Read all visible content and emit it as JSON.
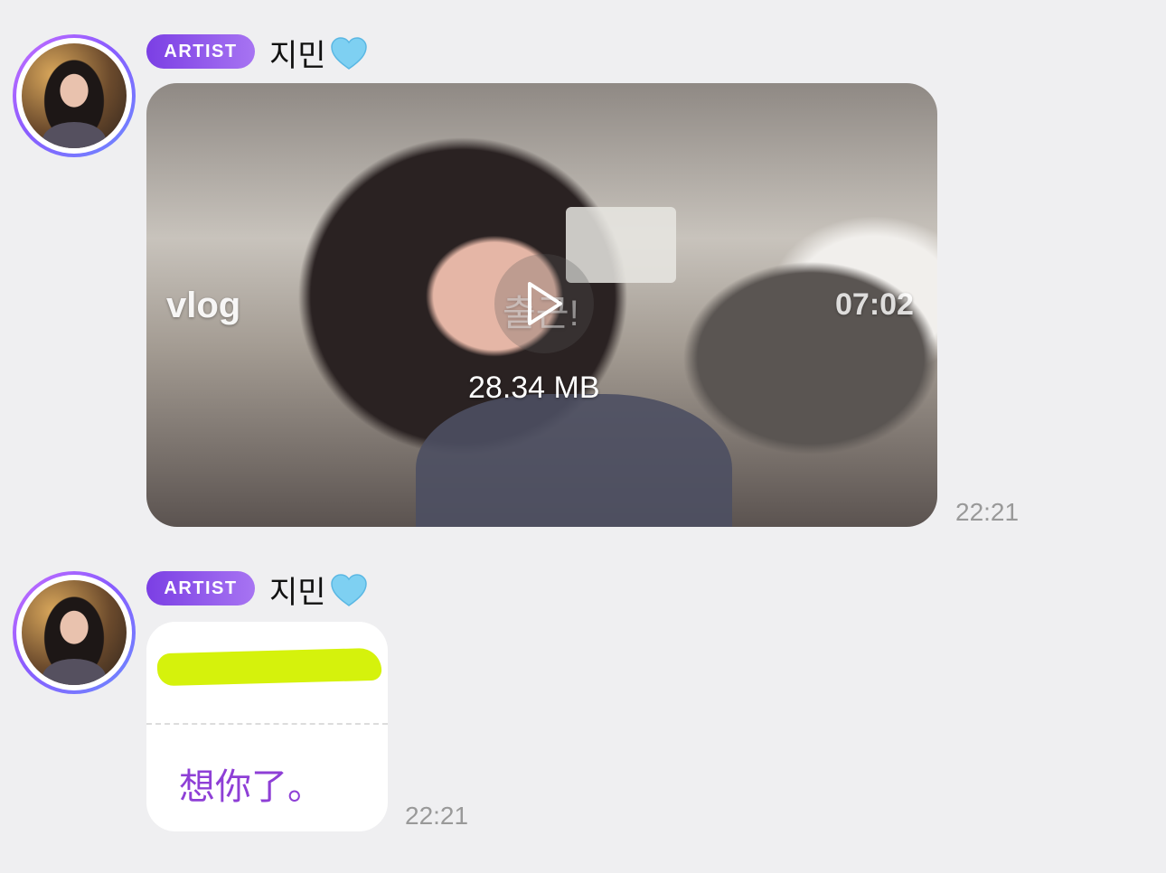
{
  "messages": [
    {
      "badge": "ARTIST",
      "sender": "지민",
      "sender_emoji": "light-blue-heart",
      "video": {
        "tag": "vlog",
        "caption": "출근!",
        "duration": "07:02",
        "size": "28.34 MB"
      },
      "time": "22:21"
    },
    {
      "badge": "ARTIST",
      "sender": "지민",
      "sender_emoji": "light-blue-heart",
      "text": {
        "translation": "想你了。"
      },
      "time": "22:21"
    }
  ],
  "colors": {
    "badge_gradient_start": "#7b3fe4",
    "badge_gradient_end": "#a774f2",
    "translation_text": "#8e3fd6",
    "highlight": "#d5f20c",
    "background": "#efeff1"
  }
}
